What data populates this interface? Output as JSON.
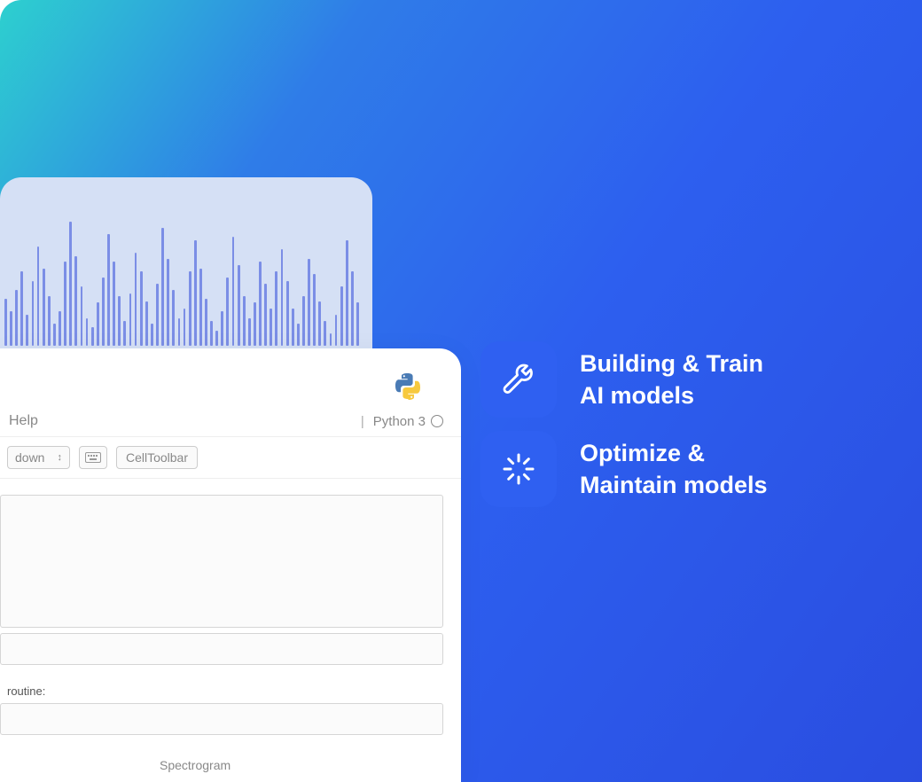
{
  "notebook": {
    "menu": {
      "help": "Help"
    },
    "kernel": "Python 3",
    "toolbar": {
      "cell_type": "down",
      "cell_toolbar_btn": "CellToolbar"
    },
    "labels": {
      "routine": "routine:",
      "spectrogram": "Spectrogram"
    }
  },
  "features": [
    {
      "name": "build-train",
      "line1": "Building & Train",
      "line2": "AI models"
    },
    {
      "name": "optimize-maintain",
      "line1": "Optimize &",
      "line2": "Maintain models"
    }
  ],
  "waveform_heights": [
    38,
    28,
    45,
    60,
    25,
    52,
    80,
    62,
    40,
    18,
    28,
    68,
    100,
    72,
    48,
    22,
    15,
    35,
    55,
    90,
    68,
    40,
    20,
    42,
    75,
    60,
    36,
    18,
    50,
    95,
    70,
    45,
    22,
    30,
    60,
    85,
    62,
    38,
    20,
    12,
    28,
    55,
    88,
    65,
    40,
    22,
    35,
    68,
    50,
    30,
    60,
    78,
    52,
    30,
    18,
    40,
    70,
    58,
    36,
    20,
    10,
    25,
    48,
    85,
    60,
    35
  ],
  "colors": {
    "accent_pill": "#2f60f1",
    "wave_bar": "#7b8ee6"
  }
}
